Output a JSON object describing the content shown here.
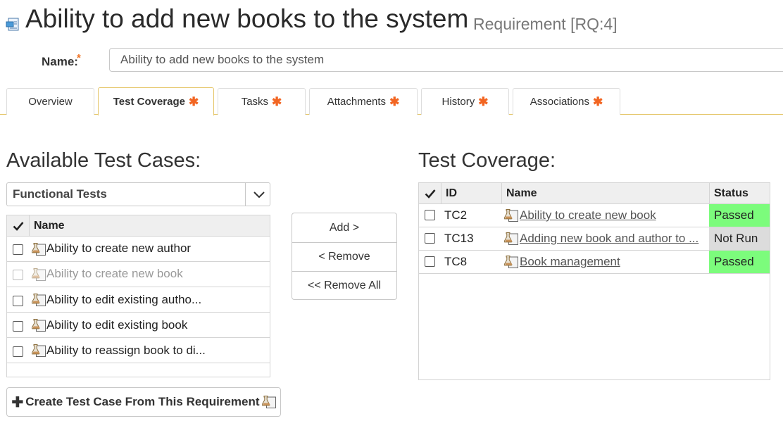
{
  "header": {
    "title": "Ability to add new books to the system",
    "subtitle": "Requirement [RQ:4]"
  },
  "name_field": {
    "label": "Name:",
    "required_mark": "*",
    "value": "Ability to add new books to the system"
  },
  "tabs": [
    {
      "label": "Overview",
      "has_changes": false,
      "active": false
    },
    {
      "label": "Test Coverage",
      "has_changes": true,
      "active": true
    },
    {
      "label": "Tasks",
      "has_changes": true,
      "active": false
    },
    {
      "label": "Attachments",
      "has_changes": true,
      "active": false
    },
    {
      "label": "History",
      "has_changes": true,
      "active": false
    },
    {
      "label": "Associations",
      "has_changes": true,
      "active": false
    }
  ],
  "tab_change_mark": "✱",
  "available": {
    "title": "Available Test Cases:",
    "folder_select": "Functional Tests",
    "column_name": "Name",
    "rows": [
      {
        "name": "Ability to create new author",
        "disabled": false
      },
      {
        "name": "Ability to create new book",
        "disabled": true
      },
      {
        "name": "Ability to edit existing autho...",
        "disabled": false
      },
      {
        "name": "Ability to edit existing book",
        "disabled": false
      },
      {
        "name": "Ability to reassign book to di...",
        "disabled": false
      }
    ]
  },
  "actions": {
    "add": "Add >",
    "remove": "< Remove",
    "remove_all": "<< Remove All"
  },
  "coverage": {
    "title": "Test Coverage:",
    "columns": {
      "id": "ID",
      "name": "Name",
      "status": "Status"
    },
    "rows": [
      {
        "id": "TC2",
        "name": "Ability to create new book",
        "status": "Passed",
        "status_color": "#7cfc7c"
      },
      {
        "id": "TC13",
        "name": "Adding new book and author to ...",
        "status": "Not Run",
        "status_color": "#dcdcdc"
      },
      {
        "id": "TC8",
        "name": "Book management",
        "status": "Passed",
        "status_color": "#7cfc7c"
      }
    ]
  },
  "create_button": {
    "icon": "plus-icon",
    "label": "Create Test Case From This Requirement"
  },
  "colors": {
    "accent_orange": "#f26522",
    "tab_border_active": "#e5c66a",
    "passed": "#7cfc7c",
    "not_run": "#dcdcdc"
  }
}
